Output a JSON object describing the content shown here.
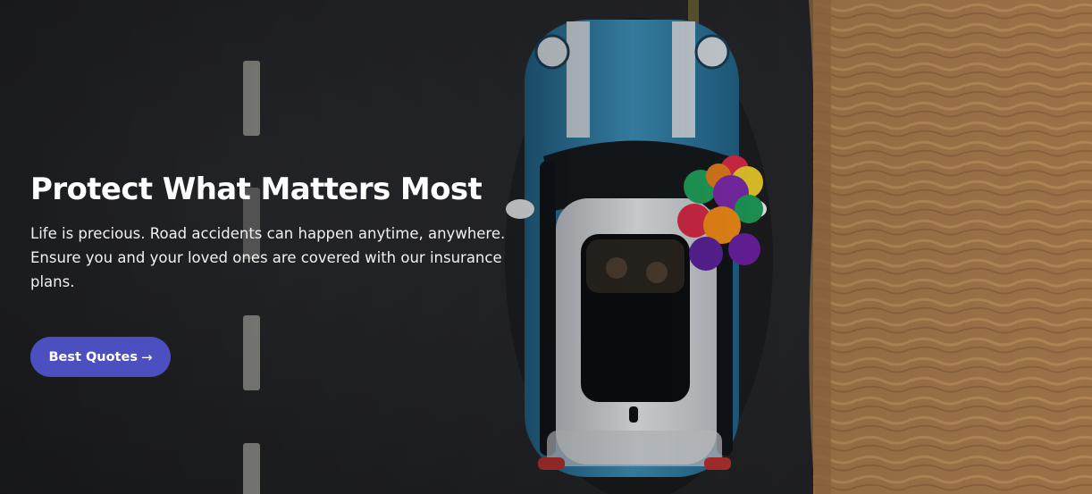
{
  "hero": {
    "title": "Protect What Matters Most",
    "description": "Life is precious. Road accidents can happen anytime, anywhere. Ensure you and your loved ones are covered with our insurance plans.",
    "cta_label": "Best Quotes",
    "cta_arrow": "→"
  },
  "colors": {
    "cta_background": "#4b4fbf",
    "road": "#2a2b2e",
    "sand": "#a07448",
    "car_body": "#3a86ad",
    "car_roof": "#d9dde0"
  },
  "icons": {
    "cta_arrow": "right-arrow-icon"
  }
}
